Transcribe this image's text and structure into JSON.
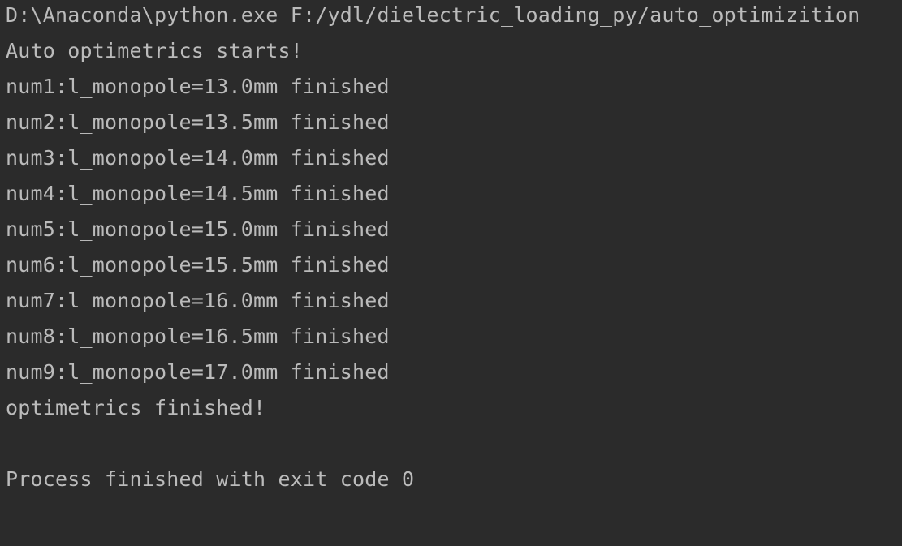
{
  "console": {
    "command_line": "D:\\Anaconda\\python.exe F:/ydl/dielectric_loading_py/auto_optimizition",
    "lines": [
      "Auto optimetrics starts!",
      "num1:l_monopole=13.0mm finished",
      "num2:l_monopole=13.5mm finished",
      "num3:l_monopole=14.0mm finished",
      "num4:l_monopole=14.5mm finished",
      "num5:l_monopole=15.0mm finished",
      "num6:l_monopole=15.5mm finished",
      "num7:l_monopole=16.0mm finished",
      "num8:l_monopole=16.5mm finished",
      "num9:l_monopole=17.0mm finished",
      "optimetrics finished!"
    ],
    "exit_message": "Process finished with exit code 0"
  },
  "colors": {
    "background": "#2b2b2b",
    "text": "#bbbbbb"
  }
}
